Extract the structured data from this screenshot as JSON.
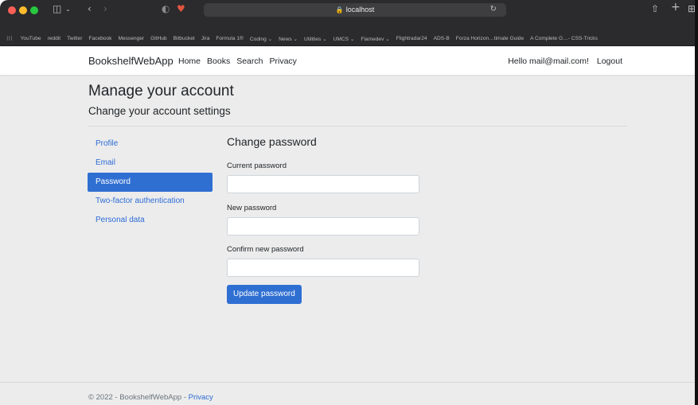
{
  "browser": {
    "address": "localhost",
    "favorites": [
      "YouTube",
      "reddit",
      "Twitter",
      "Facebook",
      "Messenger",
      "GitHub",
      "Bitbucket",
      "Jira",
      "Formula 1®",
      "Coding ⌄",
      "News ⌄",
      "Utilities ⌄",
      "UMCS ⌄",
      "Flamedev ⌄",
      "Flightradar24",
      "ADS-B",
      "Forza Horizon…timate Guide",
      "A Complete G…- CSS-Tricks"
    ]
  },
  "navbar": {
    "brand": "BookshelfWebApp",
    "links": [
      "Home",
      "Books",
      "Search",
      "Privacy"
    ],
    "greeting": "Hello mail@mail.com!",
    "logout": "Logout"
  },
  "page": {
    "title": "Manage your account",
    "subtitle": "Change your account settings"
  },
  "sidebar": {
    "items": [
      {
        "label": "Profile",
        "active": false
      },
      {
        "label": "Email",
        "active": false
      },
      {
        "label": "Password",
        "active": true
      },
      {
        "label": "Two-factor authentication",
        "active": false
      },
      {
        "label": "Personal data",
        "active": false
      }
    ]
  },
  "form": {
    "title": "Change password",
    "current_label": "Current password",
    "current_value": "",
    "new_label": "New password",
    "new_value": "",
    "confirm_label": "Confirm new password",
    "confirm_value": "",
    "submit_label": "Update password"
  },
  "footer": {
    "text": "© 2022 - BookshelfWebApp - ",
    "link": "Privacy"
  },
  "colors": {
    "accent": "#2f6fd2",
    "link": "#2d6cd6"
  }
}
